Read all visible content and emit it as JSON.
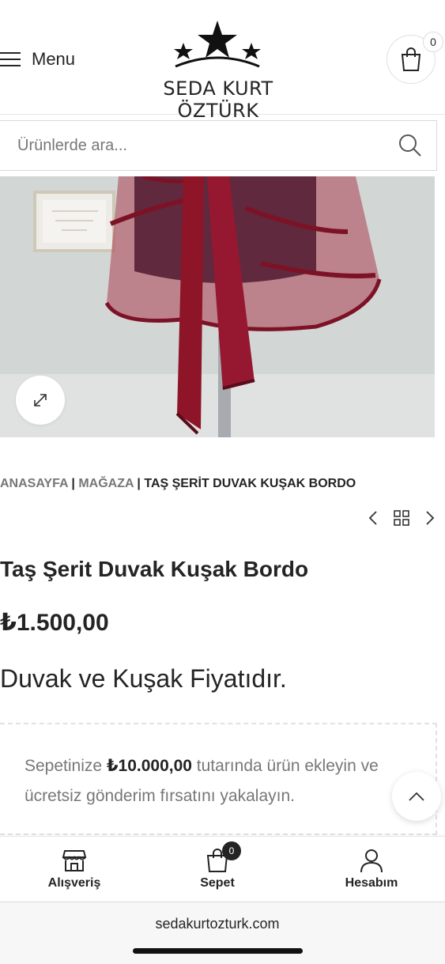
{
  "header": {
    "menu_label": "Menu",
    "brand_name": "SEDA KURT ÖZTÜRK",
    "cart_count": "0"
  },
  "search": {
    "placeholder": "Ürünlerde ara..."
  },
  "breadcrumb": {
    "home": "ANASAYFA",
    "separator": "|",
    "shop": "MAĞAZA",
    "current": "TAŞ ŞERİT DUVAK KUŞAK BORDO"
  },
  "product": {
    "title": "Taş Şerit Duvak Kuşak Bordo",
    "price": "₺1.500,00",
    "description": "Duvak ve Kuşak Fiyatıdır."
  },
  "shipping": {
    "prefix": "Sepetinize ",
    "amount": "₺10.000,00",
    "suffix": " tutarında ürün ekleyin ve ücretsiz gönderim fırsatını yakalayın."
  },
  "bottom_nav": {
    "shop_label": "Alışveriş",
    "cart_label": "Sepet",
    "cart_count": "0",
    "account_label": "Hesabım"
  },
  "browser": {
    "url": "sedakurtozturk.com"
  },
  "colors": {
    "text": "#242424",
    "muted": "#777777",
    "veil": "#9c1b34"
  }
}
